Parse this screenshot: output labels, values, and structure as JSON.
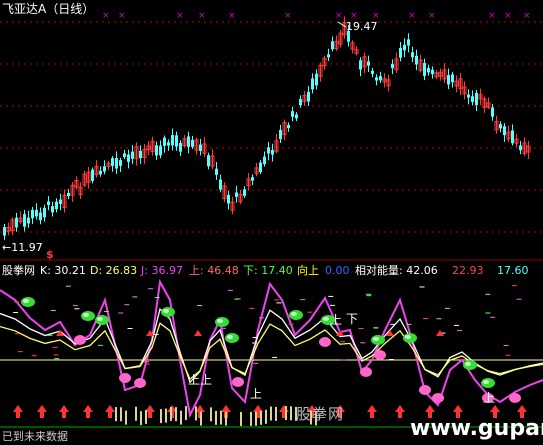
{
  "colors": {
    "up": "#ff3b3b",
    "down": "#54ffff",
    "grid": "#b40000",
    "kd_k": "#ffffff",
    "kd_d": "#ffff66",
    "j_line": "#ee44ee",
    "marker": "#cc00cc"
  },
  "price_panel": {
    "title": "飞亚达A（日线）",
    "high_label": "19.47",
    "low_label": "←11.97",
    "s_mark": "$",
    "high_price": 19.47,
    "low_price": 11.97
  },
  "indicator_panel": {
    "name": "股拳网",
    "k": "K: 30.21",
    "d": "D: 26.83",
    "j": "J: 36.97",
    "up": "上: 46.48",
    "down": "下: 17.40",
    "up_cross": "向上",
    "up_cross_value": "0.00",
    "relative_energy": "相对能量: 42.06",
    "v1": "22.93",
    "v2": "17.60",
    "marker_up": "上",
    "marker_down": "下",
    "watermark": "股拳网"
  },
  "footer": {
    "status": "已到未来数据",
    "site": "www.gupang.com"
  }
}
